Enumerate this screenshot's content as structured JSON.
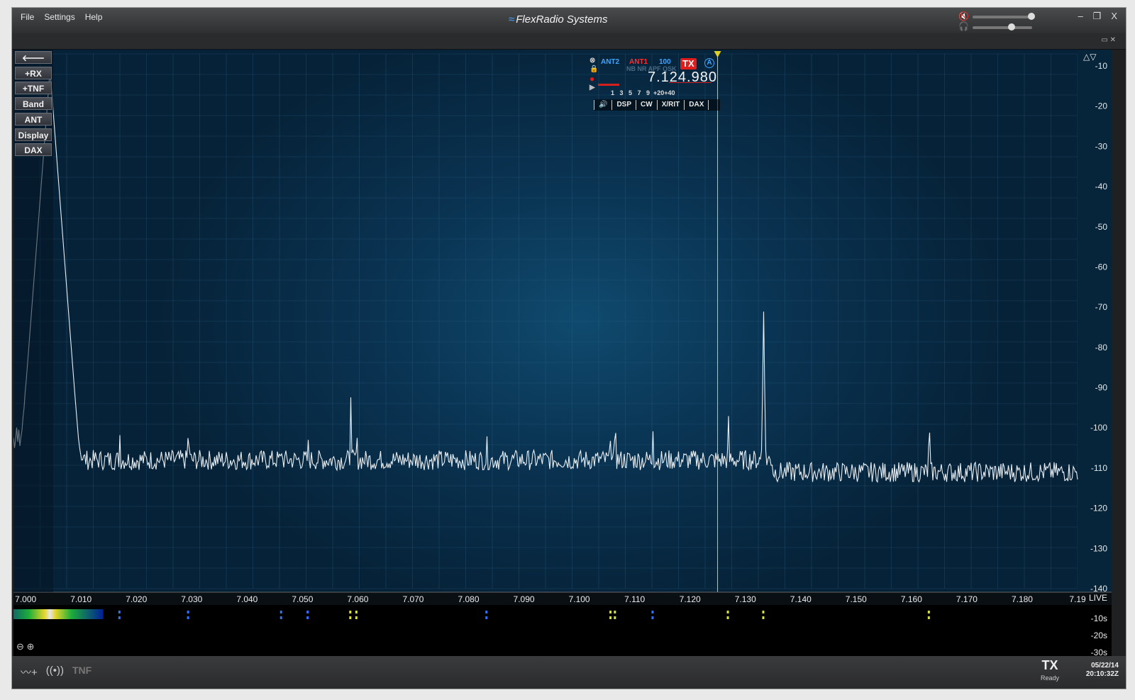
{
  "menu": {
    "file": "File",
    "settings": "Settings",
    "help": "Help"
  },
  "brand": "FlexRadio Systems",
  "window_controls": {
    "minimize": "–",
    "restore": "❐",
    "close": "X"
  },
  "side_buttons": [
    "+RX",
    "+TNF",
    "Band",
    "ANT",
    "Display",
    "DAX"
  ],
  "slice": {
    "rx_ant": "ANT2",
    "tx_ant": "ANT1",
    "filter": "100",
    "flags": "NB NR APF QSK",
    "tx": "TX",
    "letter": "A",
    "frequency": "7.124.980",
    "smeter_scale": "1   3   5   7   9  +20+40",
    "tabs": [
      "DSP",
      "CW",
      "X/RIT",
      "DAX"
    ]
  },
  "status": {
    "tnf": "TNF",
    "tx": "TX",
    "tx_state": "Ready",
    "date": "05/22/14",
    "time": "20:10:32Z"
  },
  "waterfall_labels": [
    "LIVE",
    "-10s",
    "-20s",
    "-30s"
  ],
  "colors": {
    "trace": "#e8eef2",
    "marker": "#e0d020",
    "grid": "#2f6386",
    "accent_tx": "#e21b1b"
  },
  "chart_data": {
    "type": "line",
    "xlabel": "",
    "ylabel": "",
    "xlim": [
      6.9978,
      7.19
    ],
    "ylim": [
      -140,
      -7
    ],
    "x_ticks": [
      "7.000",
      "7.010",
      "7.020",
      "7.030",
      "7.040",
      "7.050",
      "7.060",
      "7.070",
      "7.080",
      "7.090",
      "7.100",
      "7.110",
      "7.120",
      "7.130",
      "7.140",
      "7.150",
      "7.160",
      "7.170",
      "7.180",
      "7.19"
    ],
    "x_tick_values": [
      7.0,
      7.01,
      7.02,
      7.03,
      7.04,
      7.05,
      7.06,
      7.07,
      7.08,
      7.09,
      7.1,
      7.11,
      7.12,
      7.13,
      7.14,
      7.15,
      7.16,
      7.17,
      7.18,
      7.19
    ],
    "y_ticks": [
      "-10",
      "-20",
      "-30",
      "-40",
      "-50",
      "-60",
      "-70",
      "-80",
      "-90",
      "-100",
      "-110",
      "-120",
      "-130",
      "-140"
    ],
    "y_tick_values": [
      -10,
      -20,
      -30,
      -40,
      -50,
      -60,
      -70,
      -80,
      -90,
      -100,
      -110,
      -120,
      -130,
      -140
    ],
    "noise_floor": -108,
    "peaks": [
      {
        "f": 7.0044,
        "db": -11,
        "w": 0.001
      },
      {
        "f": 7.017,
        "db": -99,
        "w": 0.0002
      },
      {
        "f": 7.0294,
        "db": -98,
        "w": 0.0005
      },
      {
        "f": 7.0462,
        "db": -103,
        "w": 0.0002
      },
      {
        "f": 7.051,
        "db": -98,
        "w": 0.0002
      },
      {
        "f": 7.0587,
        "db": -87,
        "w": 0.0002
      },
      {
        "f": 7.0598,
        "db": -89,
        "w": 0.0002
      },
      {
        "f": 7.0833,
        "db": -99,
        "w": 0.0002
      },
      {
        "f": 7.1057,
        "db": -89,
        "w": 0.0002
      },
      {
        "f": 7.1065,
        "db": -85,
        "w": 0.0002
      },
      {
        "f": 7.1133,
        "db": -99,
        "w": 0.0002
      },
      {
        "f": 7.1269,
        "db": -86,
        "w": 0.0002
      },
      {
        "f": 7.1333,
        "db": -71,
        "w": 0.0004
      },
      {
        "f": 7.1632,
        "db": -85,
        "w": 0.0002
      }
    ],
    "marker_freq": 7.12498
  }
}
